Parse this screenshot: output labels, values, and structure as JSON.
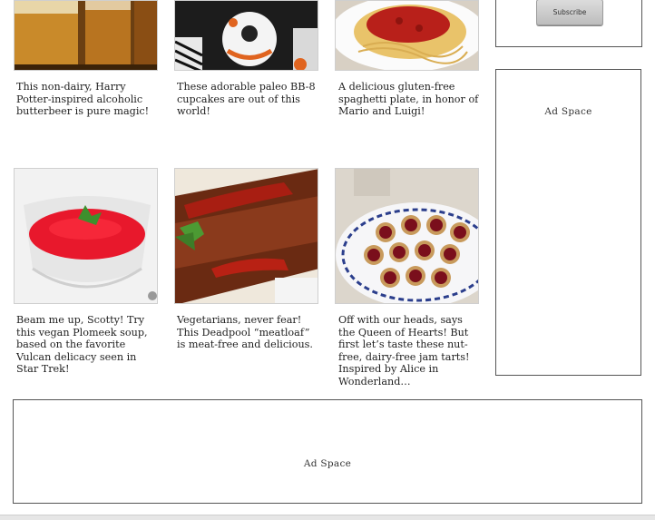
{
  "articles": [
    {
      "caption": "This non-dairy, Harry Potter-inspired alcoholic butterbeer is pure magic!",
      "image": "butterbeer-photo"
    },
    {
      "caption": "These adorable paleo BB-8 cupcakes are out of this world!",
      "image": "bb8-cupcakes-photo"
    },
    {
      "caption": "A delicious gluten-free spaghetti plate, in honor of Mario and Luigi!",
      "image": "spaghetti-photo"
    },
    {
      "caption": "Beam me up, Scotty! Try this vegan Plomeek soup, based on the favorite Vulcan delicacy seen in Star Trek!",
      "image": "plomeek-soup-photo"
    },
    {
      "caption": "Vegetarians, never fear! This Deadpool “meatloaf” is meat-free and delicious.",
      "image": "meatloaf-photo"
    },
    {
      "caption": "Off with our heads, says the Queen of Hearts! But first let’s taste these nut-free, dairy-free jam tarts! Inspired by Alice in Wonderland…",
      "image": "jam-tarts-photo"
    }
  ],
  "sidebar": {
    "subscribe_label": "Subscribe",
    "ad_label": "Ad Space"
  },
  "footer_ad": {
    "ad_label": "Ad Space"
  }
}
